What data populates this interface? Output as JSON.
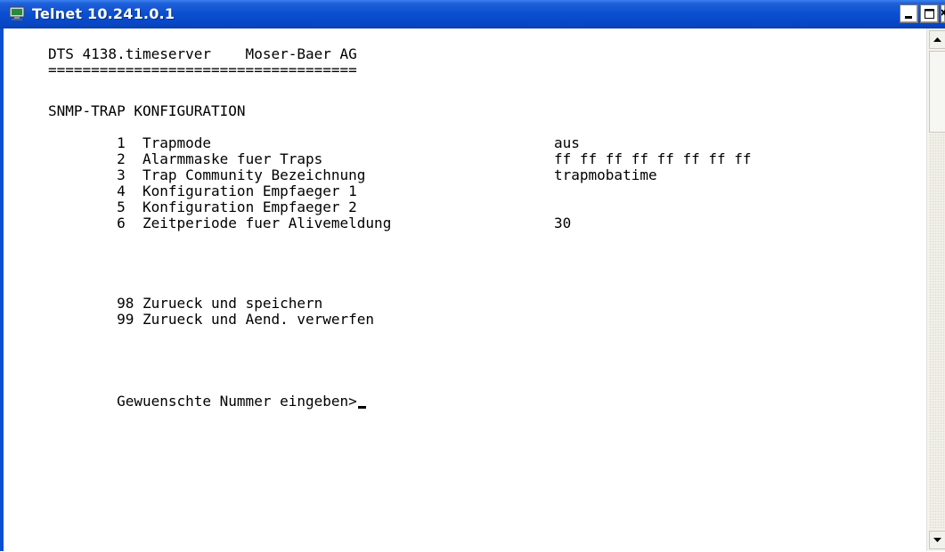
{
  "window": {
    "title": "Telnet 10.241.0.1",
    "icon": "telnet-app-icon",
    "controls": {
      "minimize": "minimize-icon",
      "maximize": "maximize-icon",
      "close": "close-icon"
    }
  },
  "terminal": {
    "header": "DTS 4138.timeserver    Moser-Baer AG",
    "separator": "====================================",
    "section_title": "SNMP-TRAP KONFIGURATION",
    "menu_items": [
      {
        "number": "1",
        "label": "Trapmode",
        "value": "aus"
      },
      {
        "number": "2",
        "label": "Alarmmaske fuer Traps",
        "value": "ff ff ff ff ff ff ff ff"
      },
      {
        "number": "3",
        "label": "Trap Community Bezeichnung",
        "value": "trapmobatime"
      },
      {
        "number": "4",
        "label": "Konfiguration Empfaeger 1",
        "value": ""
      },
      {
        "number": "5",
        "label": "Konfiguration Empfaeger 2",
        "value": ""
      },
      {
        "number": "6",
        "label": "Zeitperiode fuer Alivemeldung",
        "value": "30"
      }
    ],
    "actions": [
      {
        "number": "98",
        "label": "Zurueck und speichern"
      },
      {
        "number": "99",
        "label": "Zurueck und Aend. verwerfen"
      }
    ],
    "prompt": "Gewuenschte Nummer eingeben>"
  },
  "colors": {
    "titlebar": "#0a4fd0",
    "terminal_background": "#ffffff",
    "terminal_text": "#000000"
  }
}
